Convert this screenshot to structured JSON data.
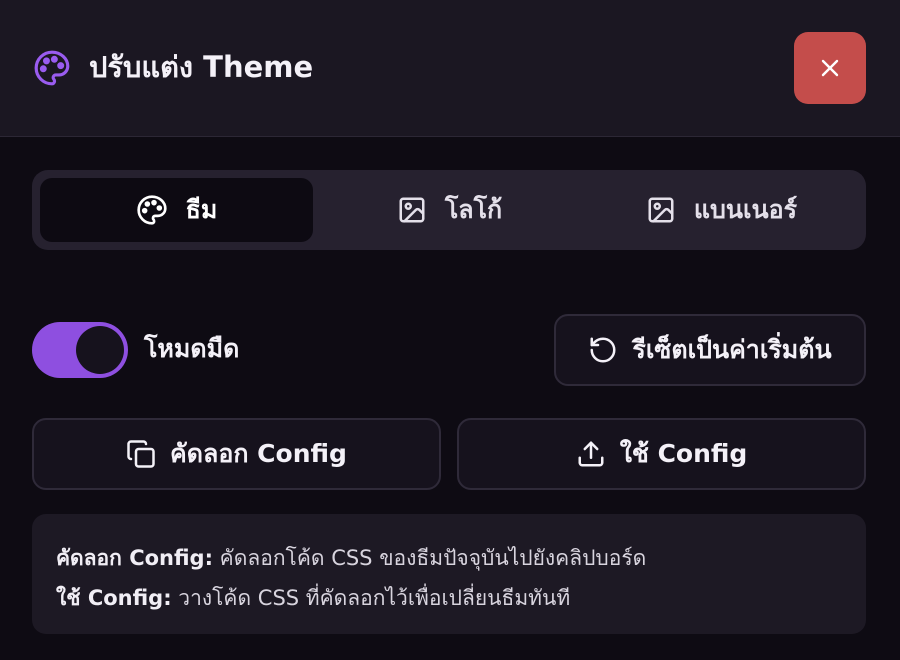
{
  "header": {
    "title": "ปรับแต่ง Theme",
    "icon": "palette-icon",
    "close_icon": "close-icon",
    "accent_color": "#9a5cf0",
    "close_color": "#c44d4b"
  },
  "tabs": [
    {
      "label": "ธีม",
      "icon": "palette-icon",
      "active": true
    },
    {
      "label": "โลโก้",
      "icon": "image-icon",
      "active": false
    },
    {
      "label": "แบนเนอร์",
      "icon": "image-icon",
      "active": false
    }
  ],
  "dark_mode": {
    "label": "โหมดมืด",
    "enabled": true,
    "color": "#8e4fe0"
  },
  "actions": {
    "reset_label": "รีเซ็ตเป็นค่าเริ่มต้น",
    "copy_label": "คัดลอก Config",
    "apply_label": "ใช้ Config"
  },
  "info": {
    "copy_term": "คัดลอก Config:",
    "copy_desc": "คัดลอกโค้ด CSS ของธีมปัจจุบันไปยังคลิปบอร์ด",
    "apply_term": "ใช้ Config:",
    "apply_desc": "วางโค้ด CSS ที่คัดลอกไว้เพื่อเปลี่ยนธีมทันที"
  }
}
